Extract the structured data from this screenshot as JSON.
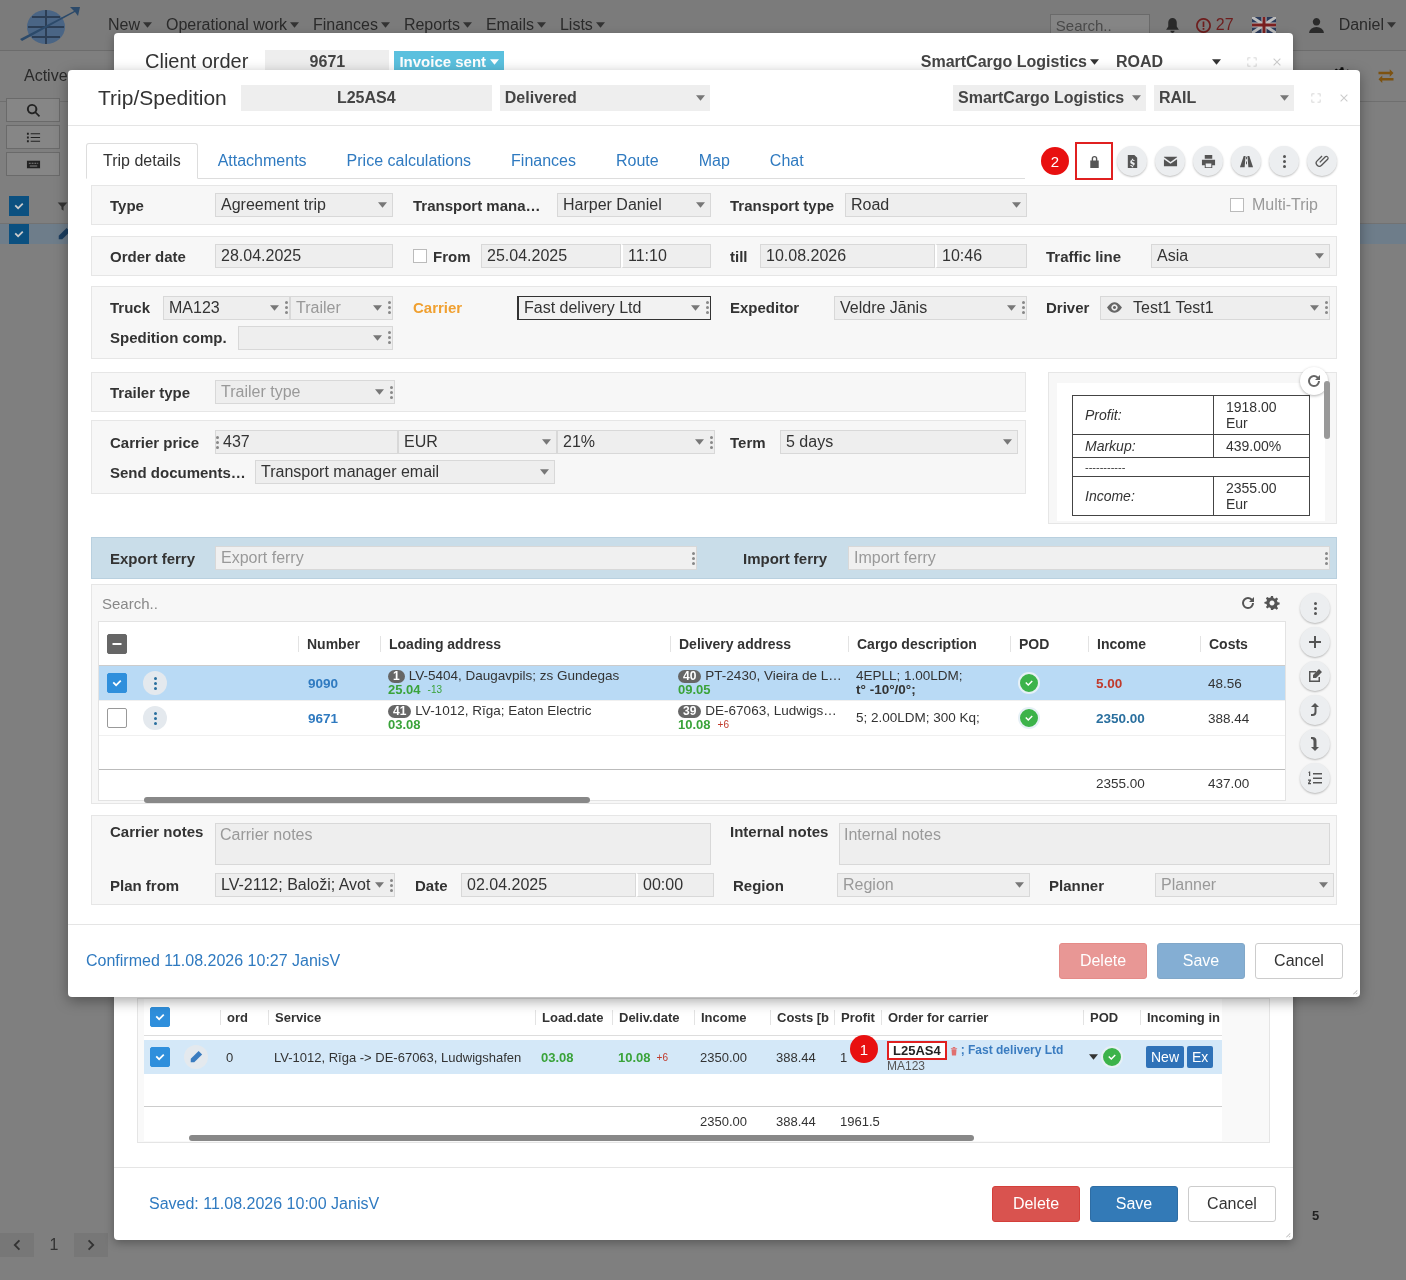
{
  "app": {
    "nav": [
      "New",
      "Operational work",
      "Finances",
      "Reports",
      "Emails",
      "Lists"
    ],
    "search": {
      "placeholder": "Search.."
    },
    "alerts": "27",
    "user": "Daniel",
    "view_label": "Active",
    "select_all": true,
    "rows": [
      {
        "selected": true
      }
    ],
    "pager": {
      "page": "1"
    },
    "count": "5"
  },
  "client_order": {
    "title": "Client order",
    "number": "9671",
    "status": "Invoice sent",
    "company": "SmartCargo Logistics",
    "mode": "ROAD",
    "services": {
      "all_selected": true,
      "columns": [
        "ord",
        "Service",
        "Load.date",
        "Deliv.date",
        "Income",
        "Costs [b",
        "Profit",
        "Order for carrier",
        "POD",
        "Incoming in"
      ],
      "rows": [
        {
          "selected": true,
          "ord": "0",
          "service": "LV-1012, Rīga -> DE-67063, Ludwigshafen",
          "load_date": "03.08",
          "deliv_date": "10.08",
          "deliv_shift": "+6",
          "income": "2350.00",
          "costs": "388.44",
          "profit": "1",
          "order_code": "L25AS4",
          "order_carrier": "; Fast delivery Ltd",
          "order_truck": "MA123",
          "pod": true,
          "buttons": [
            "New",
            "Ex"
          ]
        }
      ],
      "totals": [
        "2350.00",
        "388.44",
        "1961.5"
      ]
    },
    "callout": "1",
    "footer": {
      "status": "Saved: 11.08.2026 10:00 JanisV",
      "buttons": [
        {
          "label": "Delete",
          "kind": "danger",
          "disabled": false
        },
        {
          "label": "Save",
          "kind": "primary",
          "disabled": false
        },
        {
          "label": "Cancel",
          "kind": "default",
          "disabled": false
        }
      ]
    }
  },
  "trip": {
    "title": "Trip/Spedition",
    "number": "L25AS4",
    "status": "Delivered",
    "company": "SmartCargo Logistics",
    "mode": "RAIL",
    "tabs": [
      {
        "label": "Trip details",
        "selected": true
      },
      {
        "label": "Attachments",
        "selected": false
      },
      {
        "label": "Price calculations",
        "selected": false
      },
      {
        "label": "Finances",
        "selected": false
      },
      {
        "label": "Route",
        "selected": false
      },
      {
        "label": "Map",
        "selected": false
      },
      {
        "label": "Chat",
        "selected": false
      }
    ],
    "callout": "2",
    "type": {
      "label": "Type",
      "value": "Agreement trip"
    },
    "transport_manager": {
      "label": "Transport mana…",
      "value": "Harper Daniel"
    },
    "transport_type": {
      "label": "Transport type",
      "value": "Road"
    },
    "multi_trip": {
      "label": "Multi-Trip",
      "checked": false
    },
    "order_date": {
      "label": "Order date",
      "value": "28.04.2025"
    },
    "from": {
      "label": "From",
      "checked": false,
      "date": "25.04.2025",
      "time": "11:10"
    },
    "till": {
      "label": "till",
      "date": "10.08.2026",
      "time": "10:46"
    },
    "traffic_line": {
      "label": "Traffic line",
      "value": "Asia"
    },
    "truck": {
      "label": "Truck",
      "value": "MA123",
      "trailer_placeholder": "Trailer"
    },
    "carrier": {
      "label": "Carrier",
      "value": "Fast delivery Ltd"
    },
    "expeditor": {
      "label": "Expeditor",
      "value": "Veldre Jānis"
    },
    "driver": {
      "label": "Driver",
      "value": "Test1 Test1"
    },
    "spedition_comp": {
      "label": "Spedition comp."
    },
    "trailer_type": {
      "label": "Trailer type",
      "placeholder": "Trailer type"
    },
    "carrier_price": {
      "label": "Carrier price",
      "amount": "437",
      "currency": "EUR",
      "vat": "21%"
    },
    "term": {
      "label": "Term",
      "value": "5 days"
    },
    "send_documents": {
      "label": "Send documents…",
      "value": "Transport manager email"
    },
    "summary": [
      {
        "label": "Profit:",
        "value": "1918.00 Eur"
      },
      {
        "label": "Markup:",
        "value": "439.00%"
      },
      {
        "label": "-----------"
      },
      {
        "label": "Income:",
        "value": "2355.00 Eur"
      }
    ],
    "export_ferry": {
      "label": "Export ferry",
      "placeholder": "Export ferry"
    },
    "import_ferry": {
      "label": "Import ferry",
      "placeholder": "Import ferry"
    },
    "cargo": {
      "search_placeholder": "Search..",
      "indeterminate": true,
      "columns": [
        "Number",
        "Loading address",
        "Delivery address",
        "Cargo description",
        "POD",
        "Income",
        "Costs"
      ],
      "rows": [
        {
          "selected": true,
          "number": "9090",
          "load_seq": "1",
          "load_addr": "LV-5404, Daugavpils; zs Gundegas",
          "load_date": "25.04",
          "load_shift": "-13",
          "del_seq": "40",
          "del_addr": "PT-2430, Vieira de L…",
          "del_date": "09.05",
          "cargo": "4EPLL; 1.00LDM;",
          "cargo_note": "t° -10°/0°;",
          "pod": true,
          "income": "5.00",
          "color": "#c0392b",
          "costs": "48.56"
        },
        {
          "selected": false,
          "number": "9671",
          "load_seq": "41",
          "load_addr": "LV-1012, Rīga; Eaton Electric",
          "load_date": "03.08",
          "del_seq": "39",
          "del_addr": "DE-67063, Ludwigs…",
          "del_date": "10.08",
          "del_shift": "+6",
          "cargo": "5; 2.00LDM; 300 Kq;",
          "pod": true,
          "income": "2350.00",
          "color": "#2a6f9e",
          "costs": "388.44"
        }
      ],
      "totals": [
        "2355.00",
        "437.00"
      ]
    },
    "carrier_notes": {
      "label": "Carrier notes",
      "placeholder": "Carrier notes"
    },
    "internal_notes": {
      "label": "Internal notes",
      "placeholder": "Internal notes"
    },
    "plan_from": {
      "label": "Plan from",
      "value": "LV-2112; Baloži; Avot"
    },
    "date": {
      "label": "Date",
      "date": "02.04.2025",
      "time": "00:00"
    },
    "region": {
      "label": "Region",
      "placeholder": "Region"
    },
    "planner": {
      "label": "Planner",
      "placeholder": "Planner"
    },
    "footer": {
      "status": "Confirmed 11.08.2026 10:27 JanisV",
      "buttons": [
        {
          "label": "Delete",
          "kind": "danger",
          "disabled": true
        },
        {
          "label": "Save",
          "kind": "primary",
          "disabled": true
        },
        {
          "label": "Cancel",
          "kind": "default",
          "disabled": false
        }
      ]
    }
  }
}
